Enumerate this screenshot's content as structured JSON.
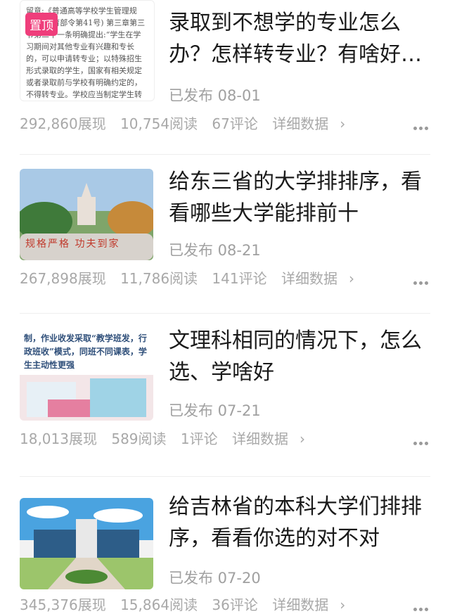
{
  "items": [
    {
      "title": "录取到不想学的专业怎么办？怎样转专业？有啥好…",
      "status": "已发布  08-01",
      "pinned": "置顶",
      "thumb_text": "留意:《普通高等学校学生管理规定》(教育部令第41号) 第三章第三节第二十一条明确提出:“学生在学习期间对其他专业有兴趣和专长的，可以申请转专业；以特殊招生形式录取的学生，国家有相关规定或者录取前与学校有明确约定的，不得转专业。学校应当制定学生转专业的具体办法，建立公平、公正的标准和程序，健全公示制度。”",
      "views": "292,860展现",
      "reads": "10,754阅读",
      "comments": "67评论",
      "details": "详细数据"
    },
    {
      "title": "给东三省的大学排排序，看看哪些大学能排前十",
      "status": "已发布  08-21",
      "thumb_text": "规格严格  功夫到家",
      "views": "267,898展现",
      "reads": "11,786阅读",
      "comments": "141评论",
      "details": "详细数据"
    },
    {
      "title": "文理科相同的情况下，怎么选、学啥好",
      "status": "已发布  07-21",
      "thumb_text": "制，作业收发采取“教学班发，行政班收”模式，同班不同课表，学生主动性更强",
      "views": "18,013展现",
      "reads": "589阅读",
      "comments": "1评论",
      "details": "详细数据"
    },
    {
      "title": "给吉林省的本科大学们排排序，看看你选的对不对",
      "status": "已发布  07-20",
      "views": "345,376展现",
      "reads": "15,864阅读",
      "comments": "36评论",
      "details": "详细数据"
    }
  ],
  "colors": {
    "badge": "#ef3e7b",
    "title": "#1a1a1a",
    "meta": "#a0a0a0"
  },
  "icons": {
    "chevron": "chevron-right-icon",
    "more": "more-dots-icon"
  }
}
